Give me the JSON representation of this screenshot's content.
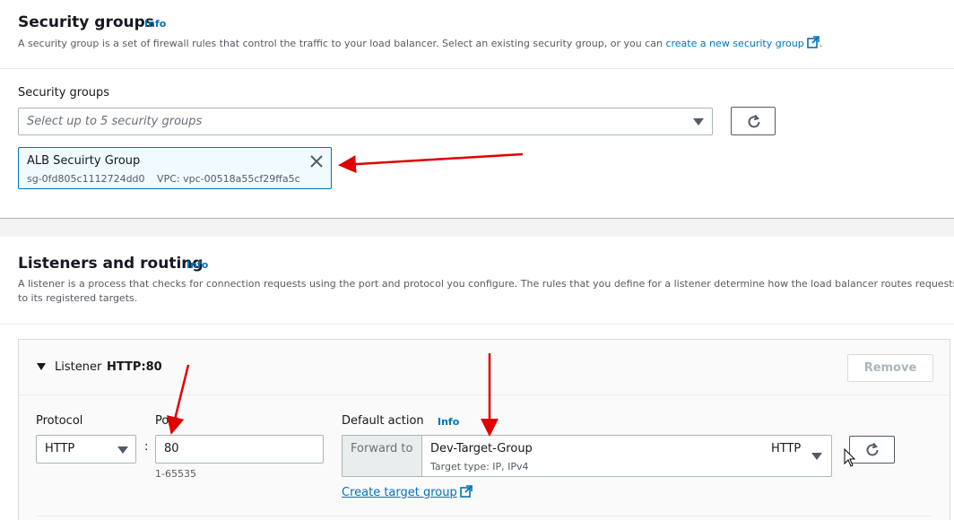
{
  "security_groups": {
    "title": "Security groups",
    "info": "Info",
    "description": "A security group is a set of firewall rules that control the traffic to your load balancer. Select an existing security group, or you can ",
    "create_link": "create a new security group",
    "description_end": ".",
    "field_label": "Security groups",
    "select_placeholder": "Select up to 5 security groups",
    "token": {
      "name": "ALB Secuirty Group",
      "id": "sg-0fd805c1112724dd0",
      "vpc": "VPC: vpc-00518a55cf29ffa5c"
    }
  },
  "listeners": {
    "title": "Listeners and routing",
    "info": "Info",
    "description_line1": "A listener is a process that checks for connection requests using the port and protocol you configure. The rules that you define for a listener determine how the load balancer routes requests",
    "description_line2": "to its registered targets.",
    "listener": {
      "label": "Listener",
      "name": "HTTP:80",
      "remove_label": "Remove",
      "protocol_label": "Protocol",
      "protocol_value": "HTTP",
      "colon": ":",
      "port_label": "Port",
      "port_value": "80",
      "port_hint": "1-65535",
      "default_action_label": "Default action",
      "default_action_info": "Info",
      "forward_to": "Forward to",
      "target_group_name": "Dev-Target-Group",
      "target_group_sub": "Target type: IP, IPv4",
      "target_group_protocol": "HTTP",
      "create_target_group": "Create target group"
    }
  },
  "colors": {
    "link": "#0073bb",
    "annotation_arrow": "#e00000",
    "token_bg": "#f1faff"
  }
}
